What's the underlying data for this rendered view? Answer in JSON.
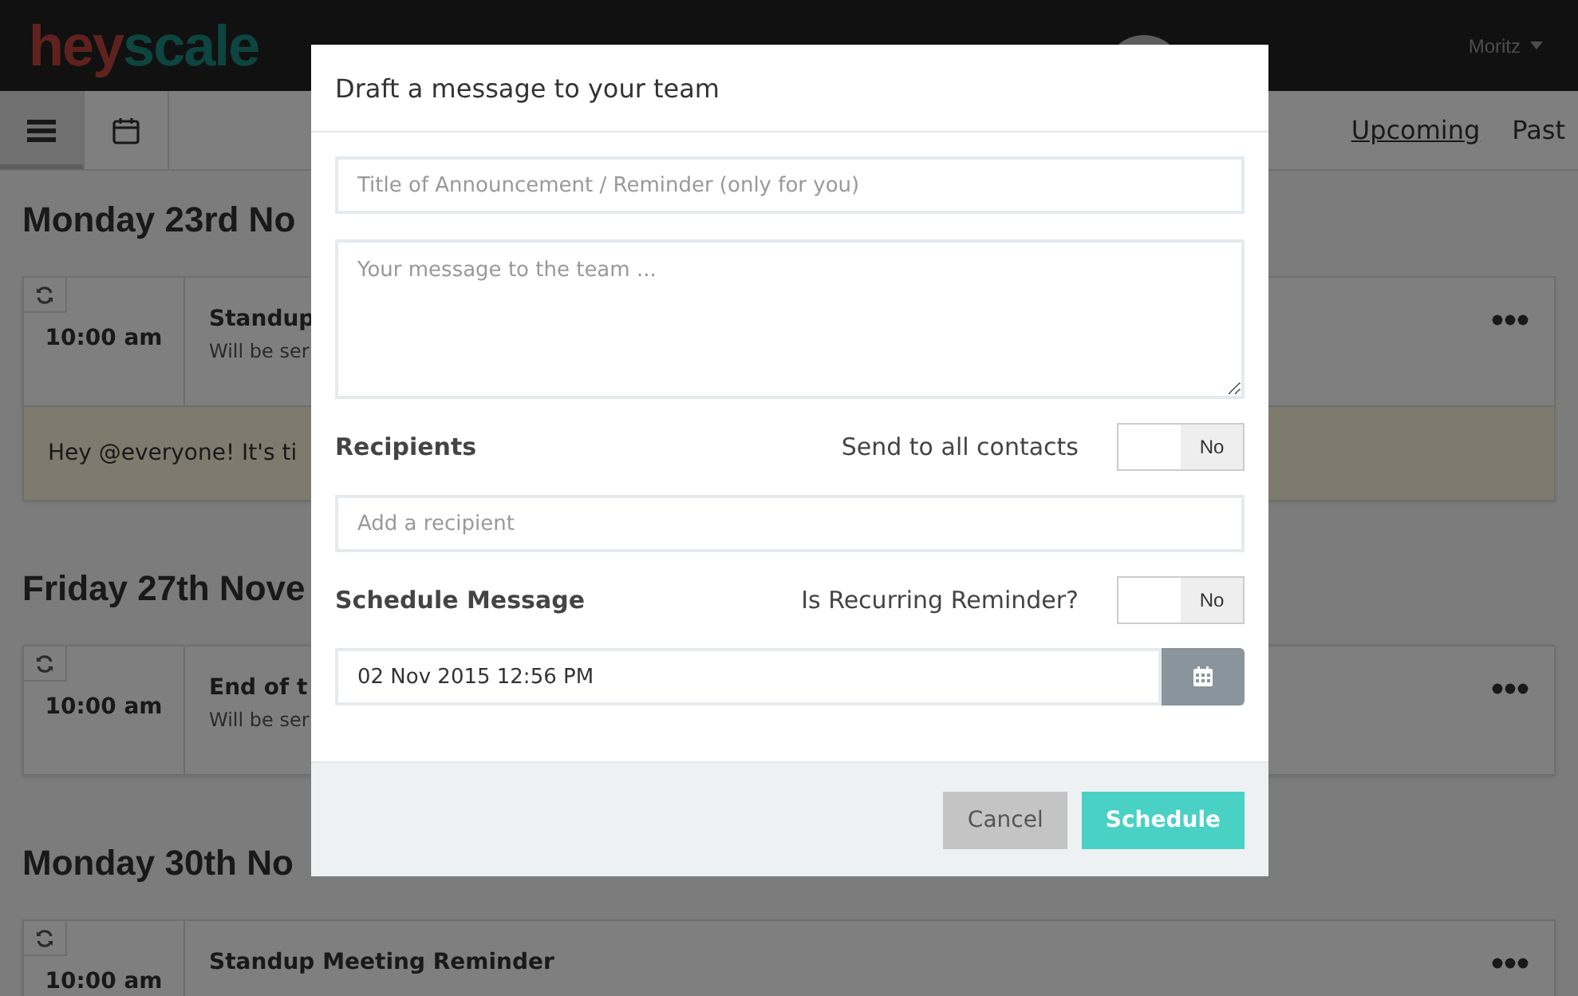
{
  "header": {
    "logo_parts": [
      "hey",
      "scale"
    ],
    "user_menu": "Moritz"
  },
  "toolbar": {
    "views": [
      {
        "kind": "menu",
        "selected": true
      },
      {
        "kind": "calendar",
        "selected": false
      }
    ],
    "filters": [
      {
        "label": "Upcoming",
        "selected": true
      },
      {
        "label": "Past",
        "selected": false
      }
    ]
  },
  "sections": [
    {
      "date": "Monday 23rd No",
      "cards": [
        {
          "time": "10:00 am",
          "title": "Standup",
          "subtitle": "Will be ser",
          "note": "Hey @everyone! It's ti"
        }
      ]
    },
    {
      "date": "Friday 27th Nove",
      "cards": [
        {
          "time": "10:00 am",
          "title": "End of t",
          "subtitle": "Will be ser"
        }
      ]
    },
    {
      "date": "Monday 30th No",
      "cards": [
        {
          "time": "10:00 am",
          "title": "Standup Meeting Reminder"
        }
      ]
    }
  ],
  "modal": {
    "title": "Draft a message to your team",
    "title_field": {
      "placeholder": "Title of Announcement / Reminder (only for you)"
    },
    "message_field": {
      "placeholder": "Your message to the team ..."
    },
    "recipients": {
      "label": "Recipients",
      "toggle_label": "Send to all contacts",
      "toggle": {
        "on": false,
        "text": "No"
      },
      "field": {
        "placeholder": "Add a recipient"
      }
    },
    "schedule": {
      "label": "Schedule Message",
      "toggle_label": "Is Recurring Reminder?",
      "toggle": {
        "on": false,
        "text": "No"
      },
      "date_field": {
        "value": "02 Nov 2015 12:56 PM"
      }
    },
    "buttons": [
      {
        "label": "Cancel",
        "kind": "secondary"
      },
      {
        "label": "Schedule",
        "kind": "primary"
      }
    ]
  }
}
